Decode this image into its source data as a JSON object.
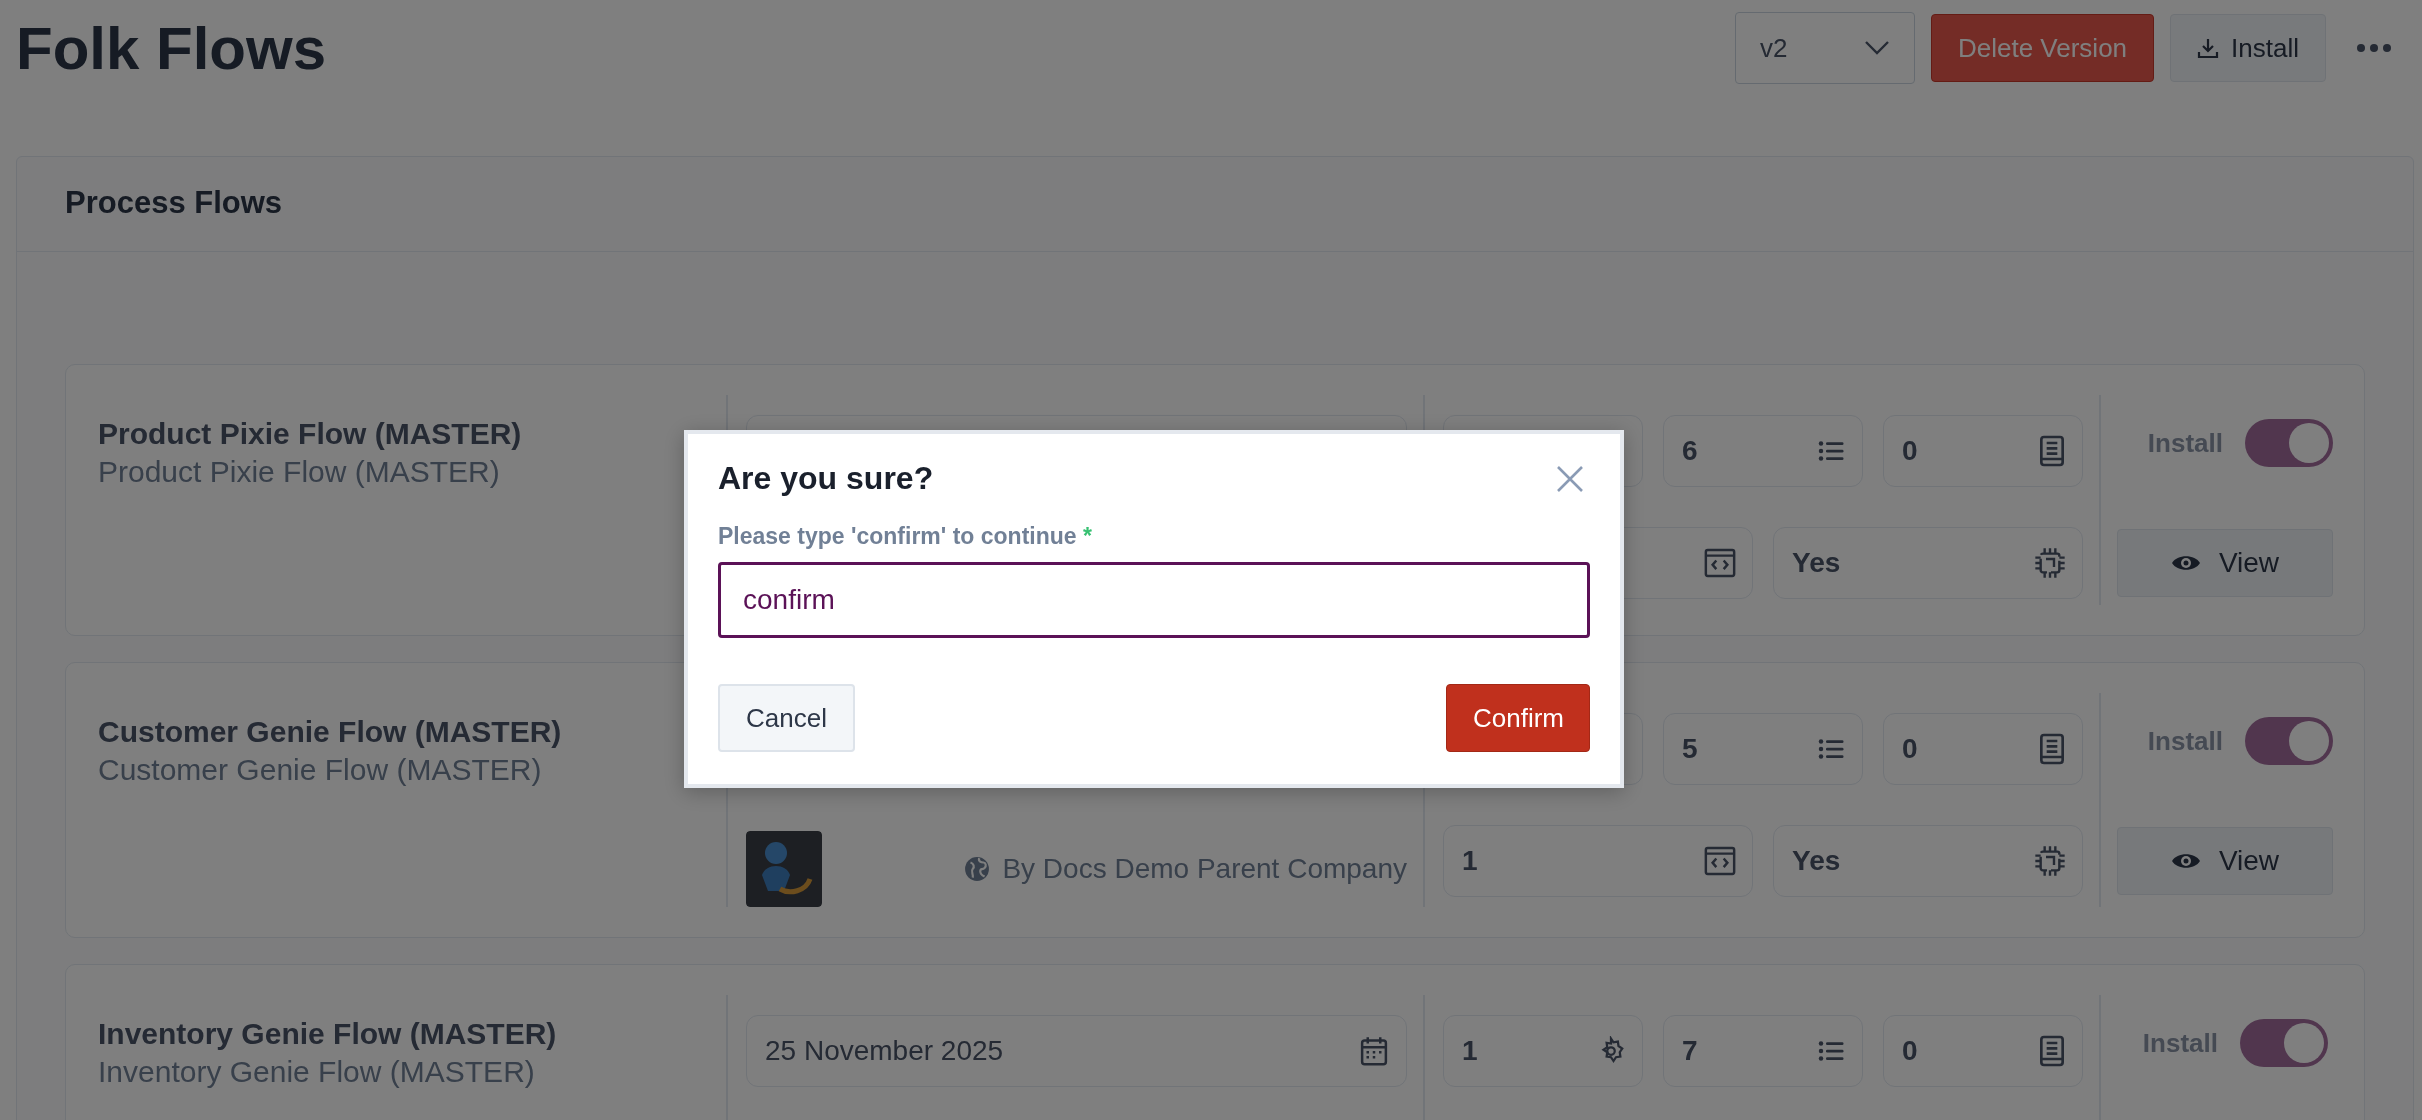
{
  "page": {
    "title": "Folk Flows"
  },
  "header_actions": {
    "version_select": {
      "value": "v2"
    },
    "delete_button": "Delete Version",
    "install_button": "Install"
  },
  "process_flows": {
    "title": "Process Flows",
    "flows": [
      {
        "name": "Product Pixie Flow (MASTER)",
        "subtitle": "Product Pixie Flow (MASTER)",
        "stats": [
          {
            "kind": "components"
          },
          {
            "kind": "steps",
            "value": "6"
          },
          {
            "kind": "docs",
            "value": "0"
          },
          {
            "kind": "code"
          },
          {
            "kind": "ai",
            "value": "Yes"
          }
        ],
        "install": {
          "label": "Install",
          "on": true
        },
        "view_button": "View"
      },
      {
        "name": "Customer Genie Flow (MASTER)",
        "subtitle": "Customer Genie Flow (MASTER)",
        "logo": true,
        "publisher": "By Docs Demo Parent Company",
        "stats": [
          {
            "kind": "components"
          },
          {
            "kind": "steps",
            "value": "5"
          },
          {
            "kind": "docs",
            "value": "0"
          },
          {
            "kind": "code",
            "value": "1"
          },
          {
            "kind": "ai",
            "value": "Yes"
          }
        ],
        "install": {
          "label": "Install",
          "on": true
        },
        "view_button": "View"
      },
      {
        "name": "Inventory Genie Flow (MASTER)",
        "subtitle": "Inventory Genie Flow (MASTER)",
        "date": "25 November 2025",
        "stats": [
          {
            "kind": "components",
            "value": "1"
          },
          {
            "kind": "steps",
            "value": "7"
          },
          {
            "kind": "docs",
            "value": "0"
          }
        ],
        "install": {
          "label": "Install",
          "on": true
        }
      }
    ]
  },
  "dialog": {
    "title": "Are you sure?",
    "label": "Please type 'confirm' to continue",
    "required_mark": "*",
    "value": "confirm",
    "cancel_button": "Cancel",
    "confirm_button": "Confirm"
  }
}
